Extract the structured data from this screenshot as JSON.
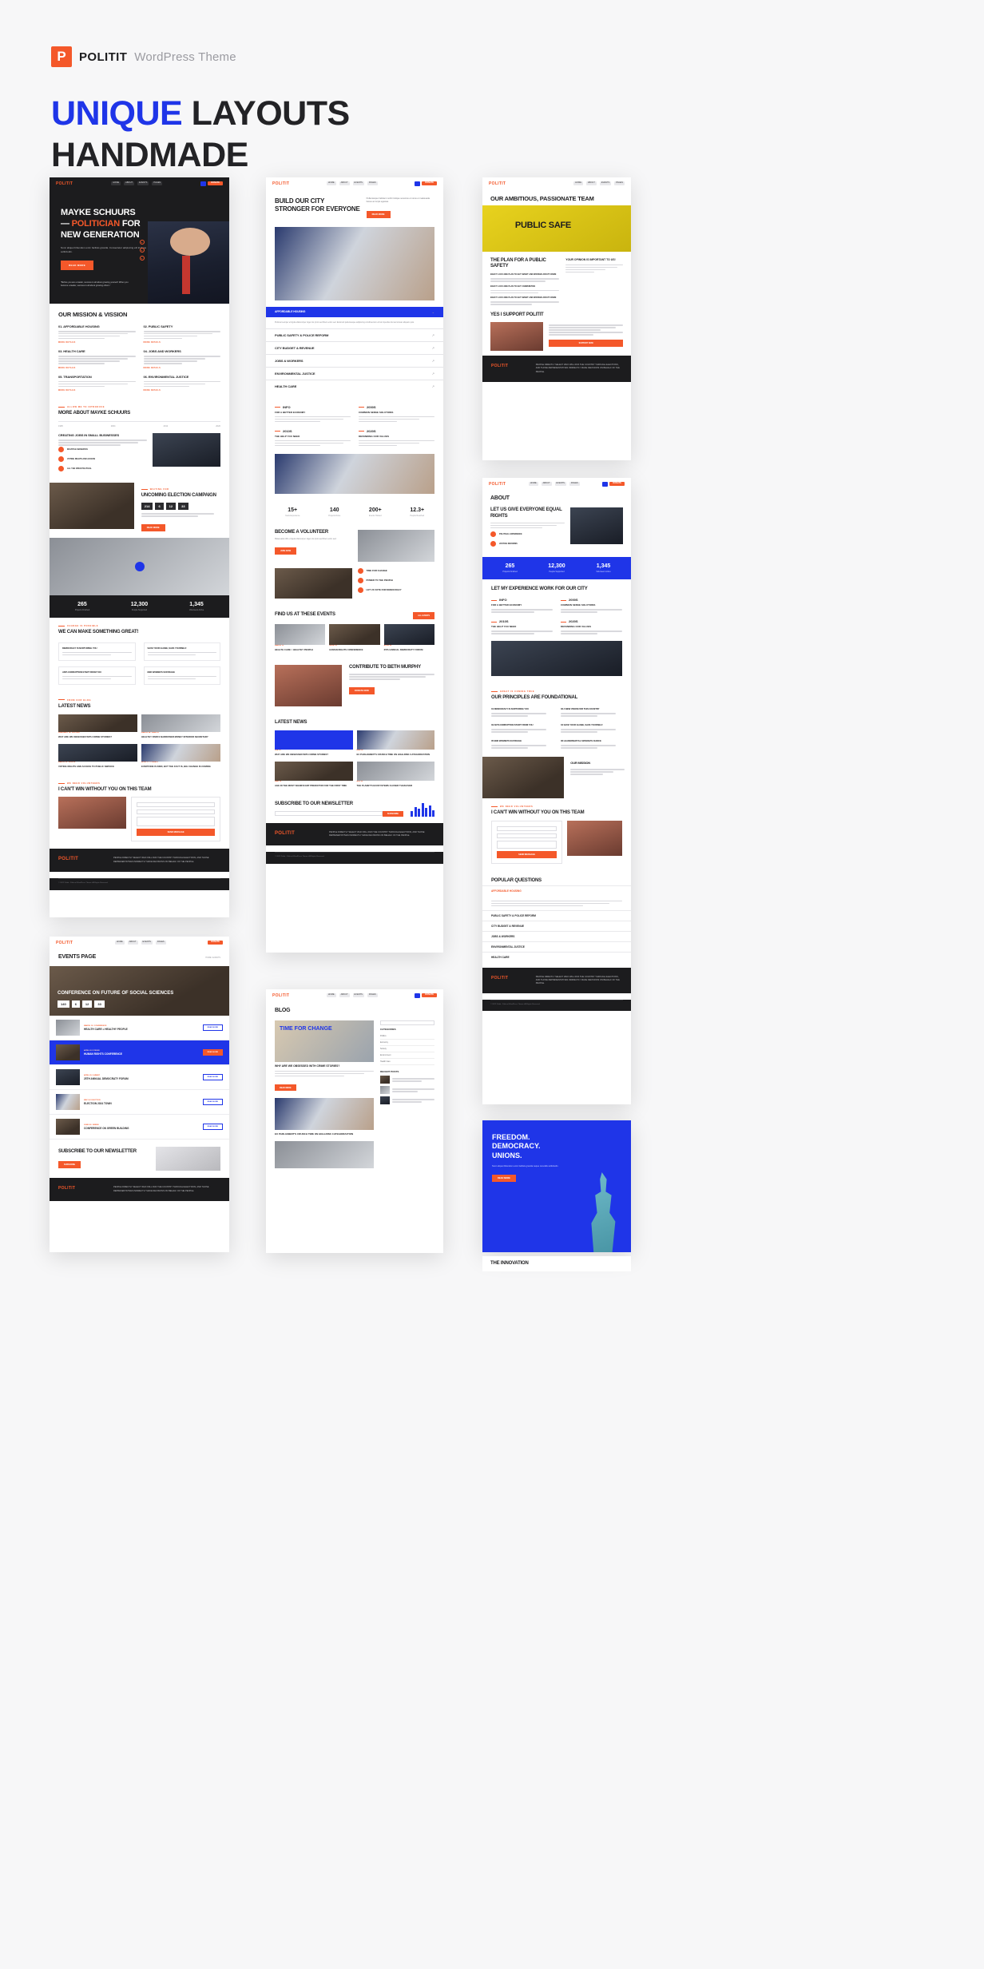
{
  "header": {
    "logo_letter": "P",
    "brand": "POLITIT",
    "subtitle": "WordPress Theme",
    "title_highlight": "UNIQUE",
    "title_rest": " LAYOUTS",
    "title_line2": "HANDMADE"
  },
  "colors": {
    "orange": "#f4582a",
    "blue": "#1f35e8",
    "dark": "#1c1c1e",
    "page_bg": "#f7f7f8"
  },
  "common": {
    "logo": "POLITIT",
    "nav": [
      "HOME",
      "ABOUT",
      "EVENTS",
      "PAGES",
      "BLOG"
    ],
    "donate": "DONATE",
    "read_more": "READ MORE",
    "more_details": "MORE DETAILS",
    "search_icon": "search-icon"
  },
  "mockups": {
    "home": {
      "hero": {
        "line1": "MAYKE SCHUURS",
        "line2_dash": "—",
        "line2_highlight": "POLITICIAN",
        "line2_rest": " FOR",
        "line3": "NEW GENERATION",
        "paragraph": "Nunc aliquet bibendum enim facilisis gravida. Consectetur adipiscing elit tristique sollicitudin.",
        "button": "READ MORE",
        "quote": "\"Before you are a leader, success is all about growing yourself. When you become a leader, success is all about growing others.\""
      },
      "mission": {
        "title": "OUR MISSION & VISSION",
        "items": [
          {
            "num": "01.",
            "title": "AFFORDABLE HOUSING",
            "link": "MORE DETAILS"
          },
          {
            "num": "02.",
            "title": "PUBLIC SAFETY",
            "link": "MORE DETAILS"
          },
          {
            "num": "03.",
            "title": "HEALTH CARE",
            "link": "MORE DETAILS"
          },
          {
            "num": "04.",
            "title": "JOBS AND WORKERS",
            "link": "MORE DETAILS"
          },
          {
            "num": "05.",
            "title": "TRANSPORTATION",
            "link": "MORE DETAILS"
          },
          {
            "num": "06.",
            "title": "ENVIRONMENTAL JUSTICE",
            "link": "MORE DETAILS"
          }
        ]
      },
      "about": {
        "eyebrow": "ALLOW ME TO INTRODUCE",
        "title": "MORE ABOUT MAYKE SCHUURS",
        "years": [
          "1995",
          "2004",
          "2012",
          "2020"
        ],
        "block_title": "CREATING JOBS IN SMALL BUSINESSES",
        "bullets": [
          "MULTIPLE MANDATES",
          "VOTING RIGHTS AND ACCESS",
          "ALL THE OPEN POLITICAL"
        ]
      },
      "campaign": {
        "eyebrow": "WAITING FOR",
        "title": "UNCOMING ELECTION CAMPAIGN",
        "countdown": [
          "214",
          "6",
          "12",
          "33"
        ],
        "countdown_labels": [
          "DAYS",
          "HRS",
          "MIN",
          "SEC"
        ],
        "button": "READ MORE"
      },
      "stats": [
        {
          "value": "265",
          "label": "Projects Finished"
        },
        {
          "value": "12,300",
          "label": "People Supported"
        },
        {
          "value": "1,345",
          "label": "Volunteers Active"
        }
      ],
      "great": {
        "eyebrow": "CHANGE IS POSSIBLE",
        "title": "WE CAN MAKE SOMETHING GREAT!",
        "cards": [
          "DEMOCRACY IS NURTURING YOU",
          "SAVE YOUR GLOBE, SAVE YOURSELF",
          "ANTI-CORRUPTION START FROM YOU",
          "END WOMEN'S SUFFRAGE"
        ]
      },
      "news": {
        "eyebrow": "FROM OUR BLOG",
        "title": "LATEST NEWS",
        "items": [
          {
            "date": "FEBRUARY 18 / PROTEST",
            "title": "WHY ARE WE OBSESSED WITH CRIME STORIES?"
          },
          {
            "date": "MARCH 04 / HEALTH",
            "title": "HEALTHY PARKS NARROWER MONEY INTERIOR SECRETARY"
          },
          {
            "date": "MARCH 22 / RIGHTS",
            "title": "VOTING RIGHTS AND ACCESS TO PUBLIC SERVICE"
          },
          {
            "date": "APRIL 11 / CLIMATE",
            "title": "EVERYONE IS KIND, BUT THE FACT IS, BIG CHANGE IS COMING"
          }
        ]
      },
      "team": {
        "eyebrow": "WE NEED VOLUNTEERS",
        "title": "I CAN'T WIN WITHOUT YOU ON THIS TEAM",
        "fields": [
          "Your Name",
          "Your Email",
          "Your Message"
        ],
        "submit": "SEND MESSAGE"
      },
      "footer": {
        "logo": "POLITIT",
        "text": "PEOPLE DIRECTLY SELECT WHO WILL RUN THE COUNTRY THROUGH ELECTIONS, AND THOSE REPRESENTATIVES INDIRECTLY MAKE DECISIONS ON BEHALF OF THE PEOPLE.",
        "bottom": "© 2022 Politit - Political WordPress Theme. All Rights Reserved."
      }
    },
    "city": {
      "hero_title": "BUILD OUR CITY STRONGER FOR EVERYONE",
      "hero_paragraph": "Pellentesque habitant morbi tristique senectus et netus et malesuada fames ac turpis egestas.",
      "hero_button": "READ MORE",
      "accordion": {
        "open_label": "AFFORDABLE HOUSING",
        "open_body": "Pulvinar semper et ligula ullamcorper. Eget nis proin sed libero enim sed. Euismod pellentesque adipiscing condimentum elit at imperdiet dui accumsan aliquam quis.",
        "items": [
          "PUBLIC SAFETY & POLICE REFORM",
          "CITY BUDGET & REVENUE",
          "JOBS & WORKERS",
          "ENVIRONMENTAL JUSTICE",
          "HEALTH CARE"
        ]
      },
      "experience": {
        "title": "LET MY EXPERIENCE WORK FOR OUR CITY",
        "entries": [
          {
            "year": "INFO",
            "title": "FOR A BETTER ECONOMY"
          },
          {
            "year": "2000S",
            "title": "COMMON SENSE SOLUTIONS"
          },
          {
            "year": "2010S",
            "title": "THE HELP YOU NEED"
          },
          {
            "year": "2020S",
            "title": "DEFENDING OUR VALUES"
          }
        ]
      },
      "stats": [
        {
          "value": "15+",
          "label": "Years Experience"
        },
        {
          "value": "140",
          "label": "Projects Done"
        },
        {
          "value": "200+",
          "label": "Events Hosted"
        },
        {
          "value": "12.3+",
          "label": "People Reached"
        }
      ],
      "volunteer": {
        "title": "BECOME A VOLUNTEER",
        "paragraph": "Malesuada nibh et ligula ullamcorper. Eget nisi proin sed libero enim sed.",
        "button": "JOIN NOW",
        "points": [
          "TIME FOR CHANGE",
          "POWER TO THE PEOPLE",
          "LET US VOTE FOR DEMOCRACY"
        ]
      },
      "events": {
        "title": "FIND US AT THESE EVENTS",
        "button": "ALL EVENTS",
        "items": [
          {
            "date": "MARCH 12",
            "title": "HEALTH CARE = HEALTHY PEOPLE"
          },
          {
            "date": "APRIL 03",
            "title": "HUMAN RIGHTS CONFERENCE"
          },
          {
            "date": "APRIL 29",
            "title": "25TH ANNUAL DEMOCRATY FORUM"
          }
        ]
      },
      "contribute": {
        "title": "CONTRIBUTE TO BETH MURPHY",
        "button": "DONATE NOW"
      },
      "news": {
        "title": "LATEST NEWS",
        "items": [
          {
            "date": "FEB 18",
            "title": "WHY ARE WE OBSESSED WITH CRIME STORIES?"
          },
          {
            "date": "MAR 02",
            "title": "EU PARLIAMENT'S CRUNCH TIME ON HIGH-RISK CATEGORIZATION"
          },
          {
            "date": "MAR 19",
            "title": "AGE IN THE MOST SIGNIFICANT PREDICTOR FOR THE FIRST TIME"
          },
          {
            "date": "APR 05",
            "title": "THE PLANET'S ECOSYSTEMS CLOSER THAN EVER"
          }
        ]
      },
      "subscribe": {
        "title": "SUBSCRIBE TO OUR NEWSLETTER",
        "placeholder": "Your email address",
        "button": "SUBSCRIBE"
      },
      "footer_text": "PEOPLE DIRECTLY SELECT WHO WILL RUN THE COUNTRY THROUGH ELECTIONS, AND THOSE REPRESENTATIVES INDIRECTLY MAKE DECISIONS ON BEHALF OF THE PEOPLE."
    },
    "team_page": {
      "hero_title": "OUR AMBITIOUS, PASSIONATE TEAM",
      "plan_title": "THE PLAN FOR A PUBLIC SAFETY",
      "plan_side_title": "YOUR OPINION IS IMPORTANT TO US!",
      "plan_items": [
        "ENACT A DAY-ONE PLAN TO GET SMART AND WORKED ABOUT CRIME",
        "ENACT A DAY-ONE PLAN TO GET COMMUNITIES",
        "ENACT A DAY-ONE PLAN TO GET SMART AND WORKED ABOUT CRIME"
      ],
      "support_title": "YES I SUPPORT POLITIT",
      "support_button": "SUPPORT NOW",
      "footer_text": "PEOPLE DIRECTLY SELECT WHO WILL RUN THE COUNTRY THROUGH ELECTIONS, AND THOSE REPRESENTATIVES INDIRECTLY MAKE DECISIONS ON BEHALF OF THE PEOPLE."
    },
    "about_page": {
      "page_title": "ABOUT",
      "equal_title": "LET US GIVE EVERYONE EQUAL RIGHTS",
      "equal_points": [
        "POLITICAL EXPERIENCE",
        "JUSTICE REFORMS"
      ],
      "stats": [
        {
          "value": "265",
          "label": "Projects Finished"
        },
        {
          "value": "12,300",
          "label": "People Supported"
        },
        {
          "value": "1,345",
          "label": "Volunteers Active"
        }
      ],
      "experience_title": "LET MY EXPERIENCE WORK FOR OUR CITY",
      "experience_entries": [
        {
          "year": "INFO",
          "title": "FOR A BETTER ECONOMY"
        },
        {
          "year": "2000S",
          "title": "COMMON SENSE SOLUTIONS"
        },
        {
          "year": "2010S",
          "title": "THE HELP YOU NEED"
        },
        {
          "year": "2020S",
          "title": "DEFENDING OUR VALUES"
        }
      ],
      "principles": {
        "eyebrow": "GREAT IS COMING TRUE",
        "title": "OUR PRINCIPLES ARE FOUNDATIONAL",
        "items": [
          {
            "num": "01",
            "title": "DEMOCRACY IS NURTURING YOU"
          },
          {
            "num": "02",
            "title": "A NEW VISION FOR THIS COUNTRY"
          },
          {
            "num": "03",
            "title": "ANTI-CORRUPTION START FROM YOU"
          },
          {
            "num": "04",
            "title": "SAVE YOUR GLOBE, SAVE YOURSELF"
          },
          {
            "num": "05",
            "title": "END WOMEN'S SUFFRAGE"
          },
          {
            "num": "06",
            "title": "LEADERSHIP IS A WOMAN'S CHOICE"
          }
        ]
      },
      "mission_title": "OUR MISSION",
      "team_title": "I CAN'T WIN WITHOUT YOU ON THIS TEAM",
      "team_eyebrow": "WE NEED VOLUNTEERS",
      "questions_title": "POPULAR QUESTIONS",
      "questions": [
        "AFFORDABLE HOUSING",
        "PUBLIC SAFETY & POLICE REFORM",
        "CITY BUDGET & REVENUE",
        "JOBS & WORKERS",
        "ENVIRONMENTAL JUSTICE",
        "HEALTH CARE"
      ],
      "footer_text": "PEOPLE DIRECTLY SELECT WHO WILL RUN THE COUNTRY THROUGH ELECTIONS, AND THOSE REPRESENTATIVES INDIRECTLY MAKE DECISIONS ON BEHALF OF THE PEOPLE."
    },
    "events_page": {
      "page_title": "EVENTS PAGE",
      "breadcrumb": "HOME / EVENTS",
      "featured_title": "CONFERENCE ON FUTURE OF SOCIAL SCIENCES",
      "countdown": [
        "140",
        "6",
        "12",
        "33"
      ],
      "items": [
        {
          "meta": "MARCH 12 / CONFERENCE",
          "title": "HEALTH CARE = HEALTHY PEOPLE",
          "button": "READ MORE"
        },
        {
          "meta": "APRIL 03 / FORUM",
          "title": "HUMAN RIGHTS CONFERENCE",
          "button": "READ MORE",
          "active": true
        },
        {
          "meta": "APRIL 29 / SUMMIT",
          "title": "25TH ANNUAL DEMOCRATY FORUM",
          "button": "READ MORE"
        },
        {
          "meta": "MAY 14 / ELECTION",
          "title": "ELECTION 2024 TOWN",
          "button": "READ MORE"
        },
        {
          "meta": "JUNE 02 / GREEN",
          "title": "CONFERENCE ON GREEN BUILDING",
          "button": "READ MORE"
        }
      ],
      "subscribe_title": "SUBSCRIBE TO OUR NEWSLETTER",
      "subscribe_button": "SUBSCRIBE",
      "footer_text": "PEOPLE DIRECTLY SELECT WHO WILL RUN THE COUNTRY THROUGH ELECTIONS, AND THOSE REPRESENTATIVES INDIRECTLY MAKE DECISIONS ON BEHALF OF THE PEOPLE."
    },
    "blog_page": {
      "page_title": "BLOG",
      "featured_banner": "TIME FOR CHANGE",
      "post_title": "WHY ARE WE OBSESSED WITH CRIME STORIES?",
      "post_excerpt": "Nunc aliquet bibendum enim facilisis gravida neque convallis. Consectetur adipiscing elit tristique sollicitudin.",
      "post_button": "READ MORE",
      "post2_title": "EU PARLIAMENT'S CRUNCH TIME ON HIGH-RISK CATEGORIZATION",
      "sidebar": {
        "search_placeholder": "Search...",
        "categories_title": "CATEGORIES",
        "categories": [
          "Politics",
          "Economy",
          "Society",
          "Environment",
          "Health Care"
        ],
        "recent_title": "RECENT POSTS"
      }
    },
    "freedom_page": {
      "title_line1": "FREEDOM.",
      "title_line2": "DEMOCRACY.",
      "title_line3": "UNIONS.",
      "paragraph": "Nunc aliquet bibendum enim facilisis gravida neque convallis sollicitudin.",
      "button": "READ MORE",
      "below_title": "THE INNOVATION"
    }
  }
}
